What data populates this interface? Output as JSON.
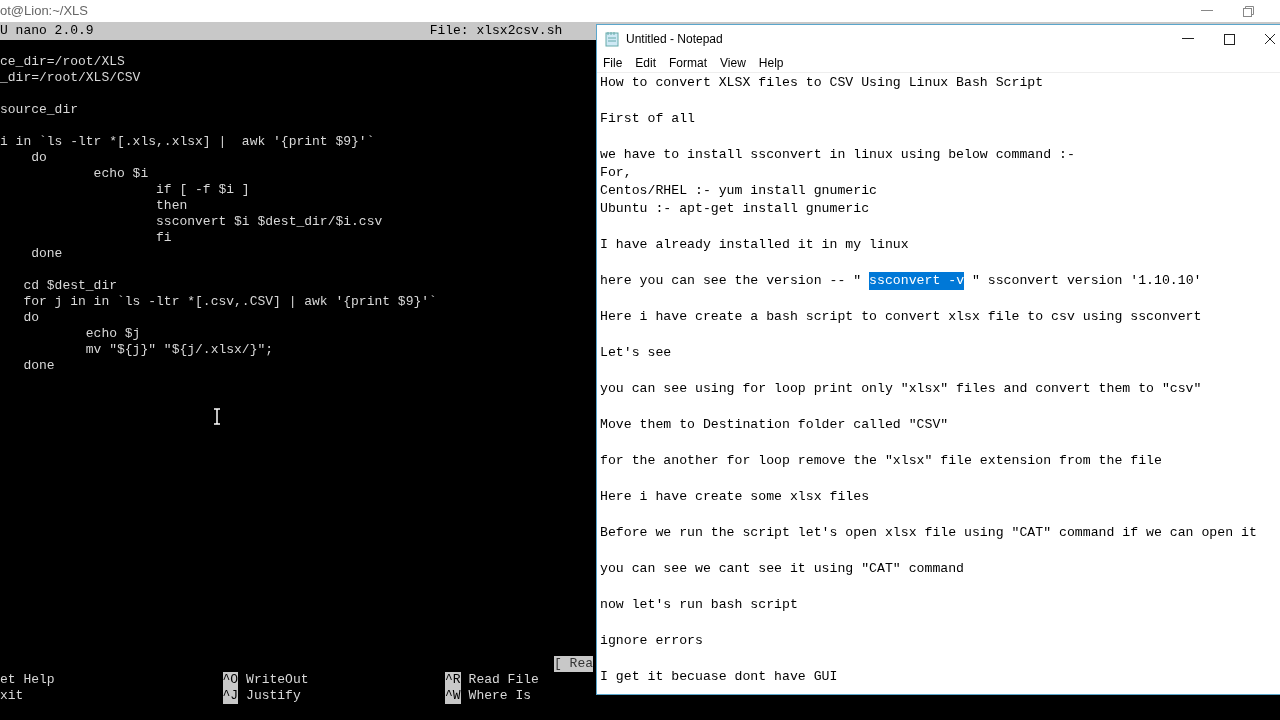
{
  "terminal": {
    "title": "ot@Lion:~/XLS",
    "header": {
      "program": "U nano 2.0.9",
      "file": "File: xlsx2csv.sh"
    },
    "blocks": [
      [
        "ce_dir=/root/XLS",
        "_dir=/root/XLS/CSV"
      ],
      [
        "source_dir"
      ],
      [
        "i in `ls -ltr *[.xls,.xlsx] |  awk '{print $9}'`",
        "    do",
        "            echo $i",
        "                    if [ -f $i ]",
        "                    then",
        "                    ssconvert $i $dest_dir/$i.csv",
        "                    fi",
        "    done"
      ],
      [
        "   cd $dest_dir",
        "   for j in in `ls -ltr *[.csv,.CSV] | awk '{print $9}'`",
        "   do",
        "           echo $j",
        "           mv \"${j}\" \"${j/.xlsx/}\";",
        "   done"
      ]
    ],
    "status": "[ Rea",
    "shortcut_rows": [
      [
        {
          "label": "et Help"
        },
        {
          "key": "^O",
          "label": "WriteOut"
        },
        {
          "key": "^R",
          "label": "Read File"
        }
      ],
      [
        {
          "label": "xit"
        },
        {
          "key": "^J",
          "label": "Justify"
        },
        {
          "key": "^W",
          "label": "Where Is"
        }
      ]
    ]
  },
  "notepad": {
    "title": "Untitled - Notepad",
    "menu": [
      "File",
      "Edit",
      "Format",
      "View",
      "Help"
    ],
    "paragraphs": [
      [
        [
          {
            "text": "How to convert XLSX files to CSV Using Linux Bash Script",
            "selected": false
          }
        ]
      ],
      [
        [
          {
            "text": "First of all",
            "selected": false
          }
        ]
      ],
      [
        [
          {
            "text": "we have to install ssconvert in linux using below command :-",
            "selected": false
          }
        ],
        [
          {
            "text": "For,",
            "selected": false
          }
        ],
        [
          {
            "text": "Centos/RHEL :- yum install gnumeric",
            "selected": false
          }
        ],
        [
          {
            "text": "Ubuntu :- apt-get install gnumeric",
            "selected": false
          }
        ]
      ],
      [
        [
          {
            "text": "I have already installed it in my linux",
            "selected": false
          }
        ]
      ],
      [
        [
          {
            "text": "here you can see the version -- \" ",
            "selected": false
          },
          {
            "text": "ssconvert -v",
            "selected": true
          },
          {
            "text": " \" ssconvert version '1.10.10'",
            "selected": false
          }
        ]
      ],
      [
        [
          {
            "text": "Here i have create a bash script to convert xlsx file to csv using ssconvert",
            "selected": false
          }
        ]
      ],
      [
        [
          {
            "text": "Let's see",
            "selected": false
          }
        ]
      ],
      [
        [
          {
            "text": "you can see using for loop print only \"xlsx\" files and convert them to \"csv\"",
            "selected": false
          }
        ]
      ],
      [
        [
          {
            "text": "Move them to Destination folder called \"CSV\"",
            "selected": false
          }
        ]
      ],
      [
        [
          {
            "text": "for the another for loop remove the \"xlsx\" file extension from the file",
            "selected": false
          }
        ]
      ],
      [
        [
          {
            "text": "Here i have create some xlsx files",
            "selected": false
          }
        ]
      ],
      [
        [
          {
            "text": "Before we run the script let's open xlsx file using \"CAT\" command if we can open it",
            "selected": false
          }
        ]
      ],
      [
        [
          {
            "text": "you can see we cant see it using \"CAT\" command",
            "selected": false
          }
        ]
      ],
      [
        [
          {
            "text": "now let's run bash script",
            "selected": false
          }
        ]
      ],
      [
        [
          {
            "text": "ignore errors",
            "selected": false
          }
        ]
      ],
      [
        [
          {
            "text": "I get it becuase dont have GUI",
            "selected": false
          }
        ]
      ]
    ]
  }
}
